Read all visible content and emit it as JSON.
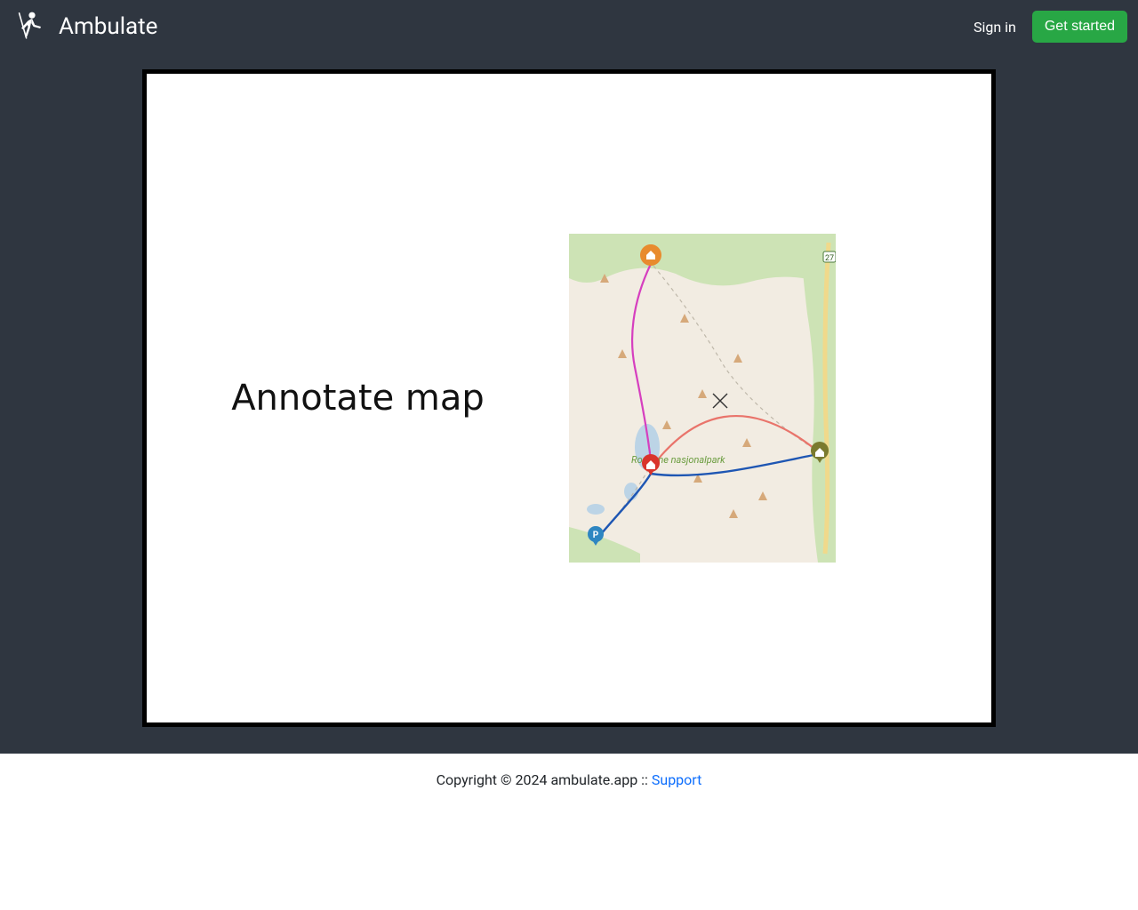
{
  "nav": {
    "brand": "Ambulate",
    "sign_in": "Sign in",
    "get_started": "Get started"
  },
  "slide": {
    "title": "Annotate map",
    "map": {
      "label": "Rondane nasjonalpark",
      "road_label": "27"
    }
  },
  "footer": {
    "copyright": "Copyright © 2024 ambulate.app :: ",
    "support": "Support"
  }
}
